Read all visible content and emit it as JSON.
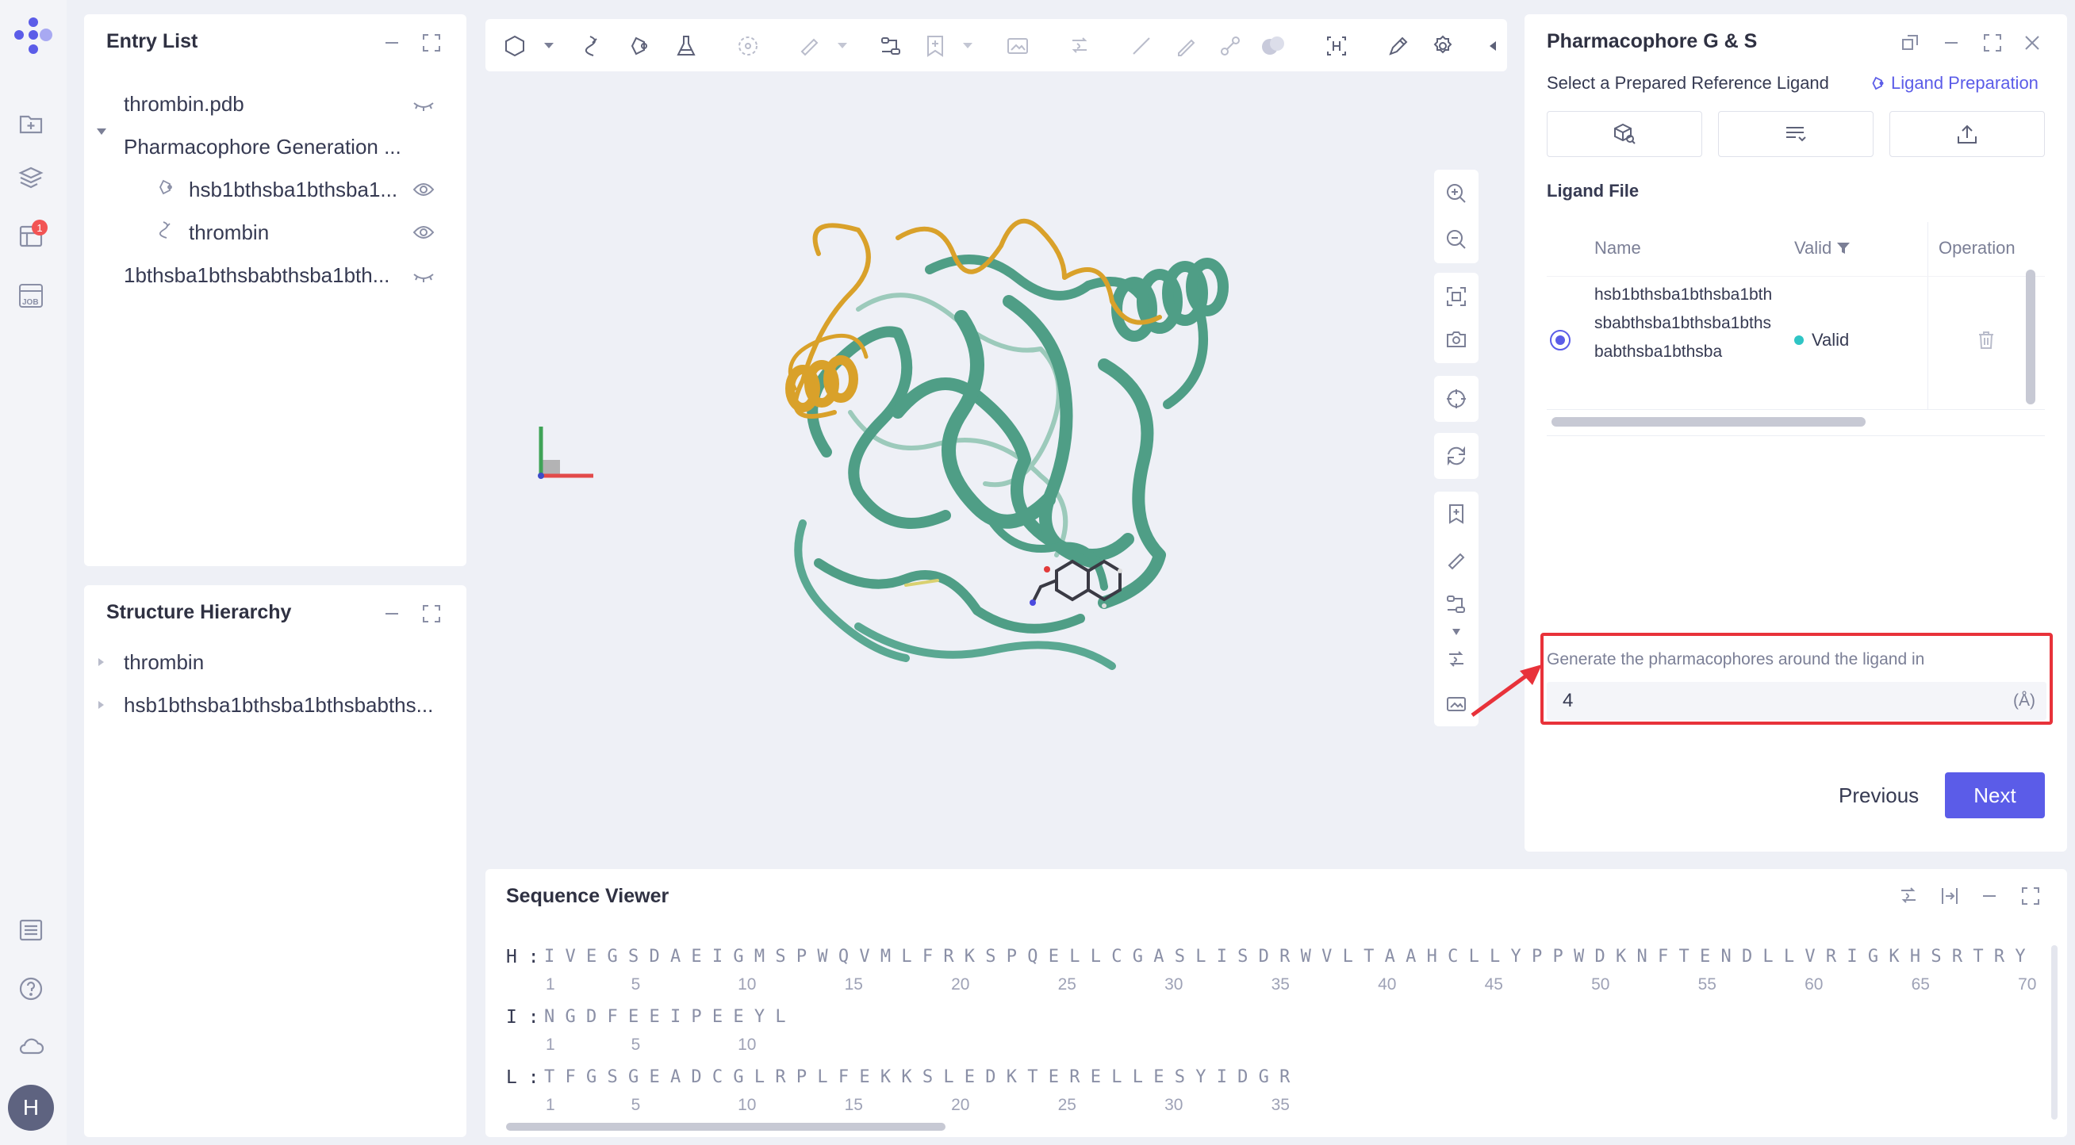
{
  "entry_list": {
    "title": "Entry List",
    "items": [
      {
        "label": "thrombin.pdb"
      },
      {
        "label": "Pharmacophore Generation ..."
      },
      {
        "label": "hsb1bthsba1bthsba1..."
      },
      {
        "label": "thrombin"
      },
      {
        "label": "1bthsba1bthsbabthsba1bth..."
      }
    ]
  },
  "structure_hierarchy": {
    "title": "Structure Hierarchy",
    "items": [
      {
        "label": "thrombin"
      },
      {
        "label": "hsb1bthsba1bthsba1bthsbabths..."
      }
    ]
  },
  "rail": {
    "notification_count": "1",
    "avatar_letter": "H"
  },
  "right_panel": {
    "title": "Pharmacophore G & S",
    "subtitle": "Select a Prepared Reference Ligand",
    "ligand_prep_link": "Ligand Preparation",
    "ligand_file_label": "Ligand File",
    "table": {
      "headers": {
        "name": "Name",
        "valid": "Valid",
        "operation": "Operation"
      },
      "rows": [
        {
          "name": "hsb1bthsba1bthsba1bthsbabthsba1bthsba1bthsbabthsba1bthsba",
          "valid": "Valid"
        }
      ]
    },
    "radius_label": "Generate the pharmacophores around the ligand in",
    "radius_value": "4",
    "radius_unit": "(Å)",
    "previous_label": "Previous",
    "next_label": "Next"
  },
  "sequence_viewer": {
    "title": "Sequence Viewer",
    "chains": [
      {
        "label": "H :",
        "sequence": "I V E G S D A E I G M S P W Q V M L F R K S P Q E L L C G A S L I S D R W V L T A A H C L L Y P P W D K N F T E N D L L V R I G K H S R T R Y",
        "numbers": [
          "1",
          "5",
          "10",
          "15",
          "20",
          "25",
          "30",
          "35",
          "40",
          "45",
          "50",
          "55",
          "60",
          "65",
          "70"
        ]
      },
      {
        "label": "I :",
        "sequence": "N G D F E E I P E E Y L",
        "numbers": [
          "1",
          "5",
          "10"
        ]
      },
      {
        "label": "L :",
        "sequence": "T F G S G E A D C G L R P L F E K K S L E D K T E R E L L E S Y I D G R",
        "numbers": [
          "1",
          "5",
          "10",
          "15",
          "20",
          "25",
          "30",
          "35"
        ]
      }
    ]
  },
  "colors": {
    "accent": "#5b5ce8",
    "protein": "#4f9e86",
    "ligand_ribbon": "#d9a12a",
    "annotation_red": "#e8323a",
    "valid_dot": "#2fc5c5"
  }
}
